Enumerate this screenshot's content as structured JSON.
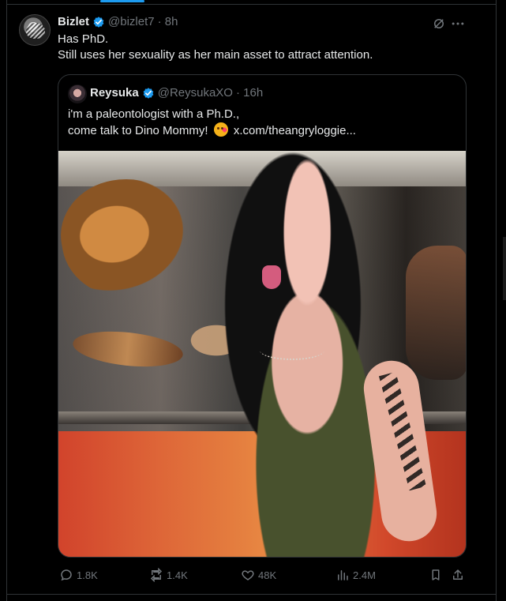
{
  "tweet": {
    "author": {
      "display_name": "Bizlet",
      "handle": "@bizlet7",
      "time": "· 8h"
    },
    "lines": [
      "Has PhD.",
      "Still uses her sexuality as her main asset to attract attention."
    ]
  },
  "quote": {
    "author": {
      "display_name": "Reysuka",
      "handle": "@ReysukaXO",
      "time": "· 16h"
    },
    "line1": "i'm a paleontologist with a Ph.D.,",
    "line2_prefix": "come talk to Dino Mommy!",
    "emoji": "kissing-face-emoji",
    "link": "x.com/theangryloggie..."
  },
  "actions": {
    "replies": "1.8K",
    "reposts": "1.4K",
    "likes": "48K",
    "views": "2.4M"
  },
  "colors": {
    "background": "#000000",
    "text": "#e7e9ea",
    "muted": "#71767b",
    "accent": "#1d9bf0"
  },
  "icons": {
    "verified": "verified-icon",
    "grok": "grok-icon",
    "more": "more-icon",
    "reply": "reply-icon",
    "repost": "repost-icon",
    "like": "heart-icon",
    "views": "views-icon",
    "bookmark": "bookmark-icon",
    "share": "share-icon"
  }
}
